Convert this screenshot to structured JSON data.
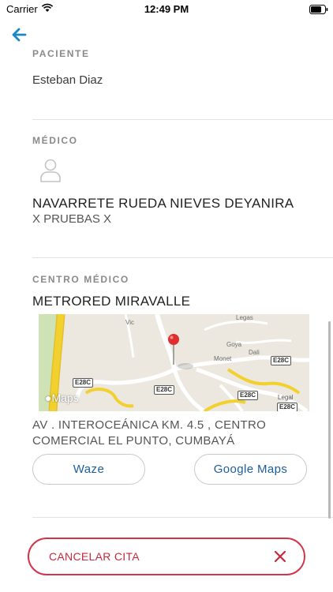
{
  "status_bar": {
    "carrier": "Carrier",
    "time": "12:49 PM"
  },
  "patient": {
    "section_label": "PACIENTE",
    "name": "Esteban Diaz"
  },
  "doctor": {
    "section_label": "MÉDICO",
    "name": "NAVARRETE RUEDA NIEVES DEYANIRA",
    "subtitle": "X PRUEBAS X"
  },
  "center": {
    "section_label": "CENTRO MÉDICO",
    "name": "METRORED MIRAVALLE",
    "address": "AV . INTEROCEÁNICA KM. 4.5 , CENTRO COMERCIAL EL PUNTO, CUMBAYÁ"
  },
  "map": {
    "provider_logo": "Maps",
    "legal_text": "Legal",
    "road_shields": [
      "E28C",
      "E28C",
      "E28C",
      "E28C",
      "E28C"
    ],
    "street_names": [
      "Goya",
      "Dali",
      "Monet",
      "Vic",
      "Legas"
    ]
  },
  "actions": {
    "waze_label": "Waze",
    "google_maps_label": "Google Maps",
    "cancel_label": "CANCELAR CITA"
  },
  "colors": {
    "accent_blue": "#1b87c9",
    "link_blue": "#1b5fa0",
    "danger_red": "#d2344a",
    "map_road_yellow": "#f2d12f",
    "pin_red": "#e02d2d"
  },
  "icons": {
    "back": "arrow-left-icon",
    "avatar": "user-outline-icon",
    "pin": "map-pin-icon",
    "cancel": "close-icon"
  }
}
